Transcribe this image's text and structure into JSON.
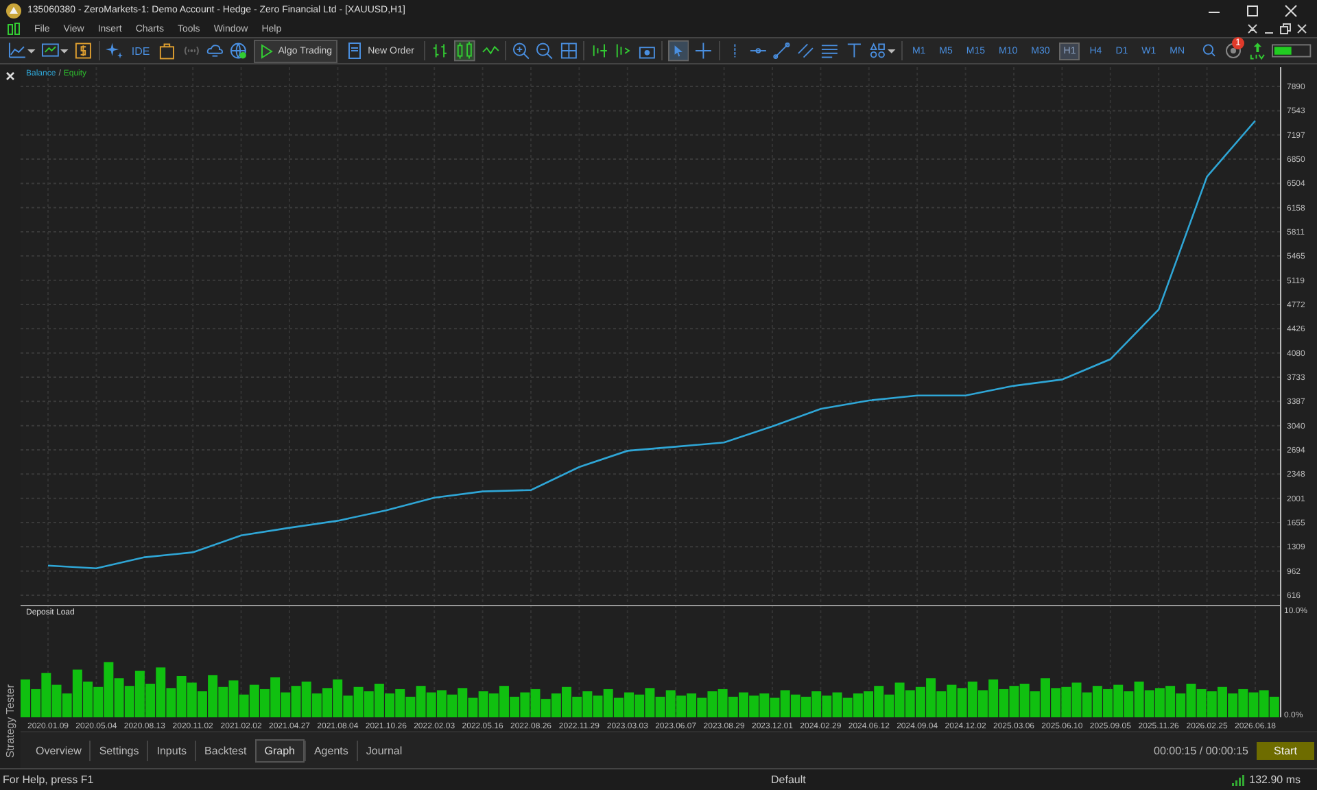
{
  "window": {
    "title": "135060380 - ZeroMarkets-1: Demo Account - Hedge - Zero Financial Ltd - [XAUUSD,H1]"
  },
  "menu": [
    "File",
    "View",
    "Insert",
    "Charts",
    "Tools",
    "Window",
    "Help"
  ],
  "toolbar": {
    "ide": "IDE",
    "algo_trading": "Algo Trading",
    "new_order": "New Order",
    "notifications": "1",
    "timeframes": [
      {
        "label": "M1",
        "selected": false
      },
      {
        "label": "M5",
        "selected": false
      },
      {
        "label": "M15",
        "selected": false
      },
      {
        "label": "M10",
        "selected": false
      },
      {
        "label": "M30",
        "selected": false
      },
      {
        "label": "H1",
        "selected": true
      },
      {
        "label": "H4",
        "selected": false
      },
      {
        "label": "D1",
        "selected": false
      },
      {
        "label": "W1",
        "selected": false
      },
      {
        "label": "MN",
        "selected": false
      }
    ]
  },
  "side_panel": {
    "title": "Strategy Tester"
  },
  "balance_chart": {
    "legend_separator": "/",
    "equity_label": {
      "label": "Equity",
      "color": "#2ec02e"
    },
    "chart_data": {
      "type": "line",
      "grid": true,
      "categories": [
        null,
        null,
        null,
        null,
        null,
        null,
        null,
        null,
        null,
        null,
        null,
        null,
        null,
        null,
        null,
        null,
        null,
        null,
        null,
        null,
        null,
        null,
        null,
        null,
        null,
        null
      ],
      "series": [
        {
          "name": "Balance",
          "color": "#2fa6d6",
          "values": [
            1040,
            1000,
            1160,
            1230,
            1470,
            1580,
            1680,
            1830,
            2010,
            2100,
            2120,
            2450,
            2680,
            2740,
            2800,
            3030,
            3280,
            3400,
            3470,
            3470,
            3610,
            3700,
            3990,
            4700,
            6600,
            7400
          ]
        }
      ],
      "ylim": [
        616,
        7890
      ],
      "yticks": [
        7890,
        7543,
        7197,
        6850,
        6504,
        6158,
        5811,
        5465,
        5119,
        4772,
        4426,
        4080,
        3733,
        3387,
        3040,
        2694,
        2348,
        2001,
        1655,
        1309,
        962,
        616
      ]
    }
  },
  "deposit_chart": {
    "chart_data": {
      "type": "bar",
      "categories": [
        null,
        null,
        null,
        null,
        null,
        null,
        null,
        null,
        null,
        null,
        null,
        null,
        null,
        null,
        null,
        null,
        null,
        null,
        null,
        null,
        null,
        null,
        null,
        null,
        null,
        null,
        null,
        null,
        null,
        null,
        null,
        null,
        null,
        null,
        null,
        null,
        null,
        null,
        null,
        null,
        null,
        null,
        null,
        null,
        null,
        null,
        null,
        null,
        null,
        null,
        null,
        null,
        null,
        null,
        null,
        null,
        null,
        null,
        null,
        null,
        null,
        null,
        null,
        null,
        null,
        null,
        null,
        null,
        null,
        null,
        null,
        null,
        null,
        null,
        null,
        null,
        null,
        null,
        null,
        null,
        null,
        null,
        null,
        null,
        null,
        null,
        null,
        null,
        null,
        null,
        null,
        null,
        null,
        null,
        null,
        null,
        null,
        null,
        null,
        null,
        null,
        null,
        null,
        null,
        null,
        null,
        null,
        null,
        null,
        null,
        null,
        null,
        null,
        null,
        null,
        null,
        null,
        null,
        null,
        null,
        null
      ],
      "ylim": [
        0,
        10
      ],
      "yticks": [
        {
          "value": 10,
          "label": "10.0%"
        },
        {
          "value": 0,
          "label": "0.0%"
        }
      ],
      "series": [
        {
          "name": "Deposit Load",
          "color": "#10c010",
          "values": [
            3.5,
            2.6,
            4.1,
            3.0,
            2.2,
            4.4,
            3.3,
            2.8,
            5.1,
            3.6,
            2.9,
            4.3,
            3.1,
            4.6,
            2.7,
            3.8,
            3.2,
            2.4,
            3.9,
            2.8,
            3.4,
            2.1,
            3.0,
            2.6,
            3.7,
            2.3,
            2.9,
            3.3,
            2.2,
            2.7,
            3.5,
            2.0,
            2.8,
            2.4,
            3.1,
            2.2,
            2.6,
            1.9,
            2.9,
            2.3,
            2.5,
            2.1,
            2.7,
            1.8,
            2.4,
            2.2,
            2.9,
            1.9,
            2.3,
            2.6,
            1.7,
            2.2,
            2.8,
            1.9,
            2.4,
            2.0,
            2.6,
            1.8,
            2.3,
            2.1,
            2.7,
            1.9,
            2.5,
            2.0,
            2.2,
            1.8,
            2.4,
            2.6,
            1.9,
            2.3,
            2.0,
            2.2,
            1.8,
            2.5,
            2.1,
            1.9,
            2.4,
            2.0,
            2.3,
            1.8,
            2.2,
            2.4,
            2.9,
            2.1,
            3.2,
            2.5,
            2.8,
            3.6,
            2.4,
            3.0,
            2.7,
            3.3,
            2.5,
            3.5,
            2.6,
            2.9,
            3.1,
            2.4,
            3.6,
            2.7,
            2.8,
            3.2,
            2.3,
            2.9,
            2.6,
            3.0,
            2.4,
            3.3,
            2.5,
            2.7,
            2.9,
            2.2,
            3.1,
            2.6,
            2.4,
            2.8,
            2.2,
            2.6,
            2.3,
            2.5,
            1.9
          ]
        }
      ]
    }
  },
  "date_axis": [
    "2020.01.09",
    "2020.05.04",
    "2020.08.13",
    "2020.11.02",
    "2021.02.02",
    "2021.04.27",
    "2021.08.04",
    "2021.10.26",
    "2022.02.03",
    "2022.05.16",
    "2022.08.26",
    "2022.11.29",
    "2023.03.03",
    "2023.06.07",
    "2023.08.29",
    "2023.12.01",
    "2024.02.29",
    "2024.06.12",
    "2024.09.04",
    "2024.12.02",
    "2025.03.06",
    "2025.06.10",
    "2025.09.05",
    "2025.11.26",
    "2026.02.25",
    "2026.06.18"
  ],
  "tabs": [
    {
      "label": "Overview",
      "selected": false
    },
    {
      "label": "Settings",
      "selected": false
    },
    {
      "label": "Inputs",
      "selected": false
    },
    {
      "label": "Backtest",
      "selected": false
    },
    {
      "label": "Graph",
      "selected": true
    },
    {
      "label": "Agents",
      "selected": false
    },
    {
      "label": "Journal",
      "selected": false
    }
  ],
  "timer": "00:00:15 / 00:00:15",
  "start_button": "Start",
  "status_bar": {
    "help": "For Help, press F1",
    "profile": "Default",
    "ping": "132.90 ms"
  }
}
